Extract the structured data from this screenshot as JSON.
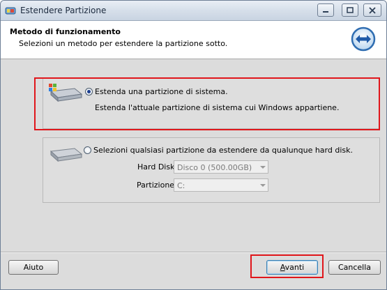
{
  "window": {
    "title": "Estendere Partizione"
  },
  "header": {
    "title": "Metodo di funzionamento",
    "subtitle": "Selezioni un metodo per estendere la partizione sotto."
  },
  "options": [
    {
      "label": "Estenda una partizione di sistema.",
      "description": "Estenda l'attuale partizione di sistema cui Windows appartiene.",
      "selected": true,
      "icon": "windows-drive-icon"
    },
    {
      "label": "Selezioni qualsiasi partizione da estendere da qualunque hard disk.",
      "selected": false,
      "icon": "drive-icon",
      "fields": {
        "hard_disk_label": "Hard Disk",
        "hard_disk_value": "Disco 0 (500.00GB)",
        "partition_label": "Partizione",
        "partition_value": "C:"
      }
    }
  ],
  "buttons": {
    "help": "Aiuto",
    "next_prefix": "",
    "next_accel": "A",
    "next_rest": "vanti",
    "cancel": "Cancella"
  },
  "colors": {
    "highlight": "#e0161b",
    "accent": "#1a3d8f"
  }
}
